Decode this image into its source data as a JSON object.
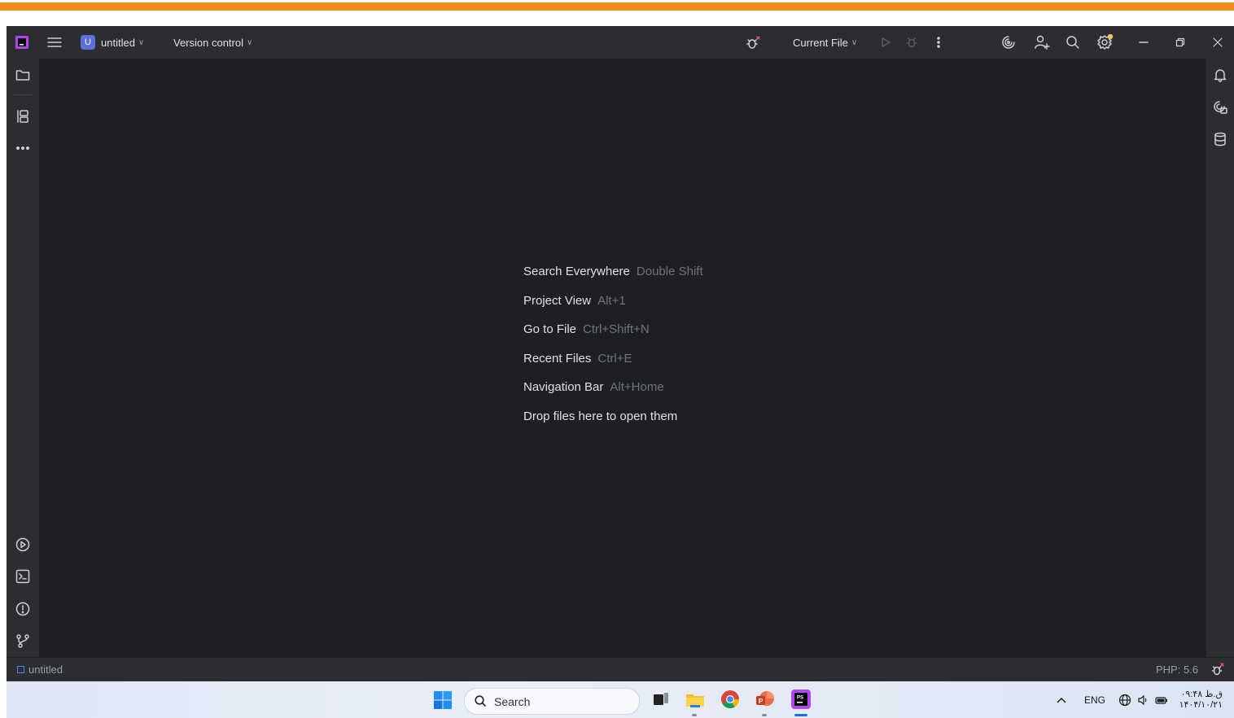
{
  "titlebar": {
    "project_badge": "U",
    "project_name": "untitled",
    "vcs_label": "Version control",
    "run_config": "Current File"
  },
  "welcome": {
    "hints": [
      {
        "action": "Search Everywhere",
        "shortcut": "Double Shift"
      },
      {
        "action": "Project View",
        "shortcut": "Alt+1"
      },
      {
        "action": "Go to File",
        "shortcut": "Ctrl+Shift+N"
      },
      {
        "action": "Recent Files",
        "shortcut": "Ctrl+E"
      },
      {
        "action": "Navigation Bar",
        "shortcut": "Alt+Home"
      }
    ],
    "drop_text": "Drop files here to open them"
  },
  "statusbar": {
    "project": "untitled",
    "php_version": "PHP: 5.6"
  },
  "taskbar": {
    "search_placeholder": "Search",
    "language": "ENG",
    "time": "۰۹:۴۸ ق.ظ",
    "date": "۱۴۰۴/۱۰/۲۱"
  },
  "colors": {
    "accent_orange": "#f28a1c",
    "ide_background": "#2b2d30",
    "editor_background": "#1e1f22",
    "project_badge": "#5f6fd7"
  }
}
